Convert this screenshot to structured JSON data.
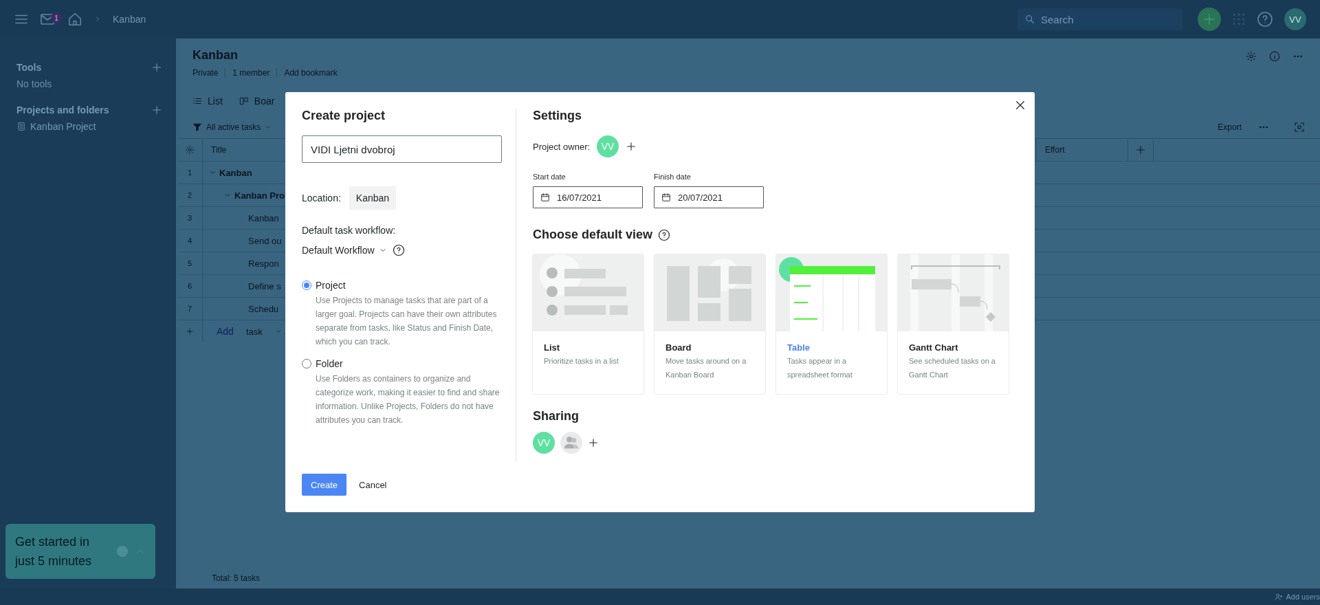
{
  "topbar": {
    "mail_badge": "1",
    "breadcrumb": "Kanban",
    "search_placeholder": "Search",
    "avatar": "VV"
  },
  "sidebar": {
    "sections": [
      {
        "title": "Tools",
        "empty_text": "No tools"
      },
      {
        "title": "Projects and folders",
        "items": [
          {
            "label": "Kanban Project"
          }
        ]
      }
    ],
    "promo": {
      "text": "Get started in just 5 minutes"
    }
  },
  "page": {
    "title": "Kanban",
    "meta": [
      "Private",
      "1 member",
      "Add bookmark"
    ],
    "views": [
      {
        "label": "List",
        "kind": "list"
      },
      {
        "label": "Boar",
        "kind": "board"
      }
    ],
    "filter": "All active tasks",
    "export": "Export",
    "table": {
      "columns": [
        "Title",
        "Effort"
      ],
      "rows": [
        {
          "number": "1",
          "title": "Kanban",
          "expanded": true,
          "children": [
            {
              "number": "2",
              "title": "Kanban Pro",
              "expanded": true,
              "children": [
                {
                  "number": "3",
                  "title": "Kanban"
                },
                {
                  "number": "4",
                  "title": "Send ou"
                },
                {
                  "number": "5",
                  "title": "Respon"
                },
                {
                  "number": "6",
                  "title": "Define s"
                },
                {
                  "number": "7",
                  "title": "Schedu"
                }
              ]
            }
          ]
        }
      ],
      "add_link": "Add",
      "add_type": "task",
      "total": "Total: 5 tasks"
    }
  },
  "status_bar": {
    "add_users": "Add users"
  },
  "modal": {
    "title": "Create project",
    "name_value": "VIDI Ljetni dvobroj",
    "location_label": "Location:",
    "location": "Kanban",
    "workflow_label": "Default task workflow:",
    "workflow": "Default Workflow",
    "types": [
      {
        "label": "Project",
        "selected": true,
        "description": "Use Projects to manage tasks that are part of a larger goal. Projects can have their own attributes separate from tasks, like Status and Finish Date, which you can track."
      },
      {
        "label": "Folder",
        "selected": false,
        "description": "Use Folders as containers to organize and categorize work, making it easier to find and share information. Unlike Projects, Folders do not have attributes you can track."
      }
    ],
    "buttons": {
      "create": "Create",
      "cancel": "Cancel"
    },
    "settings": {
      "title": "Settings",
      "owner_label": "Project owner:",
      "owner": "VV",
      "dates": [
        {
          "label": "Start date",
          "value": "16/07/2021"
        },
        {
          "label": "Finish date",
          "value": "20/07/2021"
        }
      ],
      "view_title": "Choose default view",
      "views": [
        {
          "kind": "list",
          "title": "List",
          "description": "Prioritize tasks in a list",
          "selected": false
        },
        {
          "kind": "board",
          "title": "Board",
          "description": "Move tasks around on a Kanban Board",
          "selected": false
        },
        {
          "kind": "table",
          "title": "Table",
          "description": "Tasks appear in a spreadsheet format",
          "selected": true
        },
        {
          "kind": "gantt",
          "title": "Gantt Chart",
          "description": "See scheduled tasks on a Gantt Chart",
          "selected": false
        }
      ],
      "sharing_title": "Sharing",
      "sharing": [
        {
          "kind": "user",
          "initials": "VV"
        },
        {
          "kind": "group"
        }
      ]
    }
  }
}
